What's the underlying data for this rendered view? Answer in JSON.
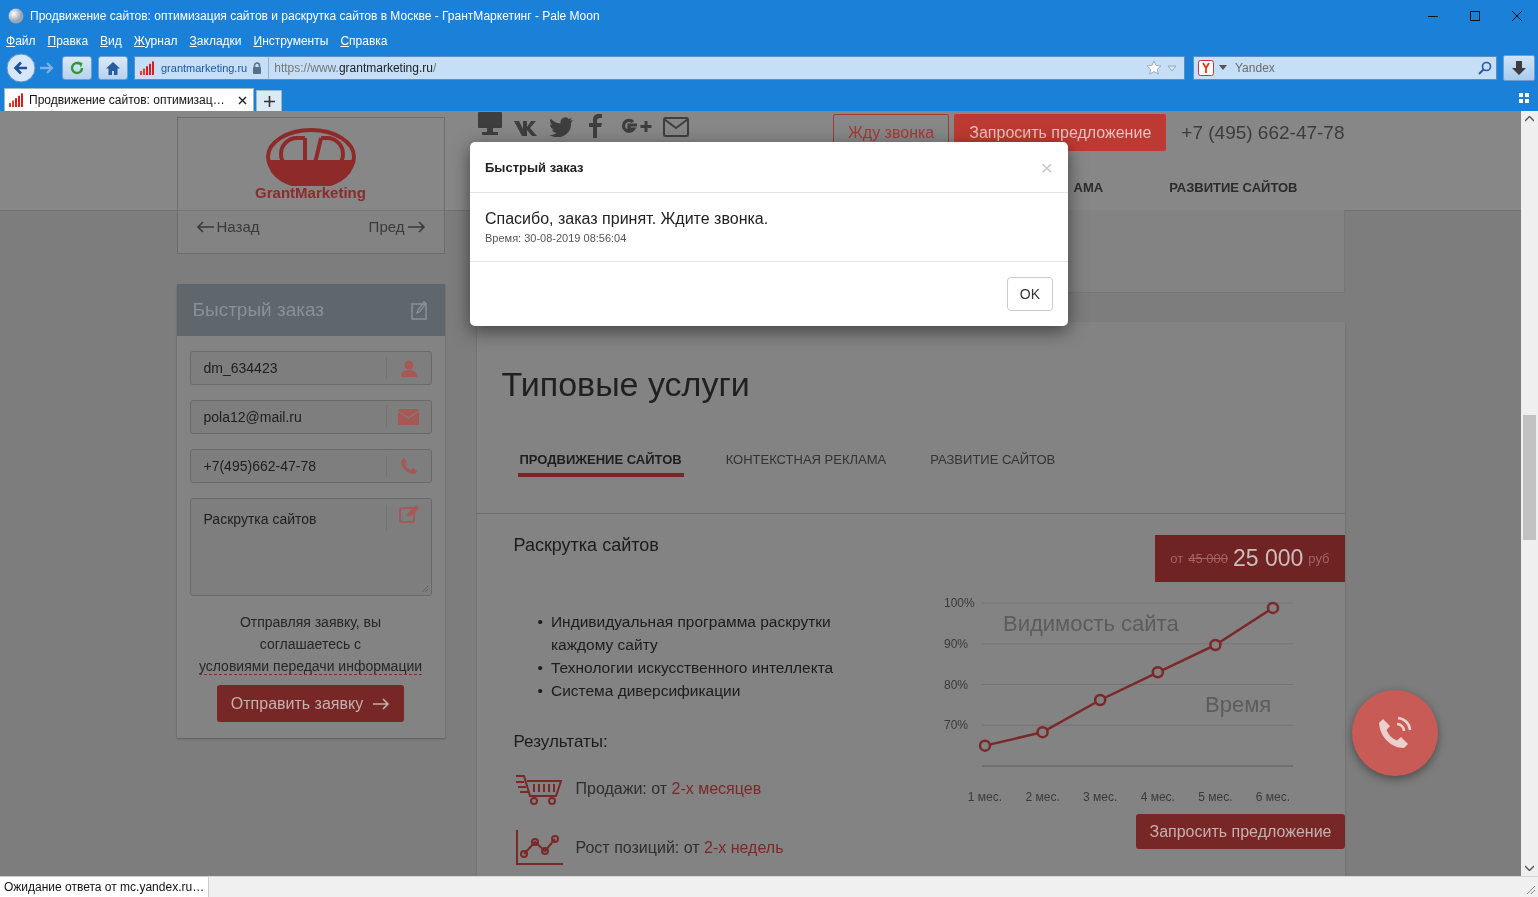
{
  "window": {
    "title": "Продвижение сайтов: оптимизация сайтов и раскрутка сайтов в Москве - ГрантМаркетинг - Pale Moon"
  },
  "menu": [
    "Файл",
    "Правка",
    "Вид",
    "Журнал",
    "Закладки",
    "Инструменты",
    "Справка"
  ],
  "toolbar": {
    "site": "grantmarketing.ru",
    "url_prefix": "https://www.",
    "url_host": "grantmarketing.ru",
    "url_suffix": "/",
    "search": {
      "placeholder": "Yandex"
    }
  },
  "tabs": [
    {
      "label": "Продвижение сайтов: оптимизац…",
      "selected": true
    }
  ],
  "header": {
    "logo": "GrantMarketing",
    "call_button": "Жду звонка",
    "offer_button": "Запросить предложение",
    "phone": "+7 (495) 662-47-78",
    "nav": [
      "АМА",
      "РАЗВИТИЕ САЙТОВ"
    ]
  },
  "sidebar": {
    "back": "Назад",
    "next": "Пред",
    "order_form": {
      "title": "Быстрый заказ",
      "fields": [
        {
          "kind": "name",
          "value": "dm_634423"
        },
        {
          "kind": "email",
          "value": "pola12@mail.ru"
        },
        {
          "kind": "phone",
          "value": "+7(495)662-47-78"
        },
        {
          "kind": "message",
          "value": "Раскрутка сайтов"
        }
      ],
      "consent_text": "Отправляя заявку, вы соглашаетесь с",
      "consent_link": "условиями передачи информации",
      "submit": "Отправить заявку"
    }
  },
  "services": {
    "title": "Типовые услуги",
    "tabs": [
      {
        "label": "ПРОДВИЖЕНИЕ САЙТОВ",
        "selected": true
      },
      {
        "label": "КОНТЕКСТНАЯ РЕКЛАМА",
        "selected": false
      },
      {
        "label": "РАЗВИТИЕ САЙТОВ",
        "selected": false
      }
    ],
    "panel": {
      "title": "Раскрутка сайтов",
      "price": {
        "prefix": "от",
        "old": "45 000",
        "value": "25 000",
        "currency": "руб"
      },
      "bullet": "•",
      "features": [
        "Индивидуальная программа раскрутки каждому сайту",
        "Технологии искусственного интеллекта",
        "Система диверсификации"
      ],
      "results_title": "Результаты:",
      "results": [
        {
          "kind": "sales",
          "label": "Продажи: от",
          "highlight": "2-х месяцев"
        },
        {
          "kind": "growth",
          "label": "Рост позиций: от",
          "highlight": "2-х недель"
        }
      ],
      "chart_data": {
        "type": "line",
        "title": "Видимость сайта",
        "xlabel": "Время",
        "categories": [
          "1 мес.",
          "2 мес.",
          "3 мес.",
          "4 мес.",
          "5 мес.",
          "6 мес."
        ],
        "grid": true,
        "series": [
          {
            "color": "#7b2828",
            "marker": "circle",
            "values": [
              65,
              68.3,
              76.2,
              83,
              89.7,
              98.8
            ]
          }
        ],
        "ylim": [
          60,
          100
        ],
        "yticks": [
          {
            "value": 70,
            "label": "70%"
          },
          {
            "value": 80,
            "label": "80%"
          },
          {
            "value": 90,
            "label": "90%"
          },
          {
            "value": 100,
            "label": "100%"
          }
        ]
      },
      "offer_button": "Запросить предложение"
    }
  },
  "dialog": {
    "title": "Быстрый заказ",
    "close": "×",
    "message": "Спасибо, заказ принят. Ждите звонка.",
    "time": "Время: 30-08-2019 08:56:04",
    "ok": "OK"
  },
  "status_bar": "Ожидание ответа от mc.yandex.ru…"
}
